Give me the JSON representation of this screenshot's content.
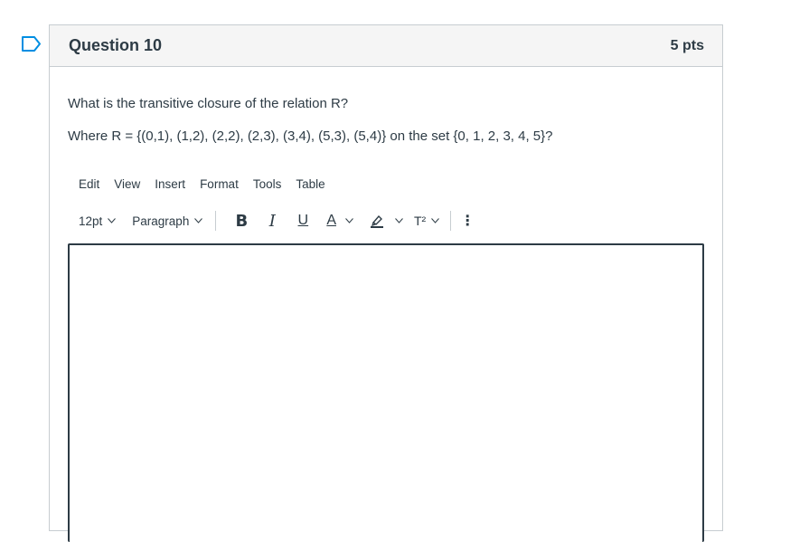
{
  "question": {
    "title": "Question 10",
    "points": "5 pts",
    "text_line1": "What is the transitive closure of the relation R?",
    "text_line2": "Where R = {(0,1), (1,2), (2,2), (2,3), (3,4), (5,3), (5,4)} on the set {0, 1, 2, 3, 4, 5}?"
  },
  "editor": {
    "menu": [
      "Edit",
      "View",
      "Insert",
      "Format",
      "Tools",
      "Table"
    ],
    "font_size": "12pt",
    "block_format": "Paragraph",
    "bold_label": "B",
    "italic_label": "I",
    "underline_label": "U",
    "text_color_label": "A",
    "superscript_label": "T²",
    "more_label": "⋮",
    "content": ""
  },
  "colors": {
    "accent": "#2d3b45",
    "flag": "#008ee2",
    "border": "#c7cdd1",
    "header_bg": "#f5f5f5"
  }
}
